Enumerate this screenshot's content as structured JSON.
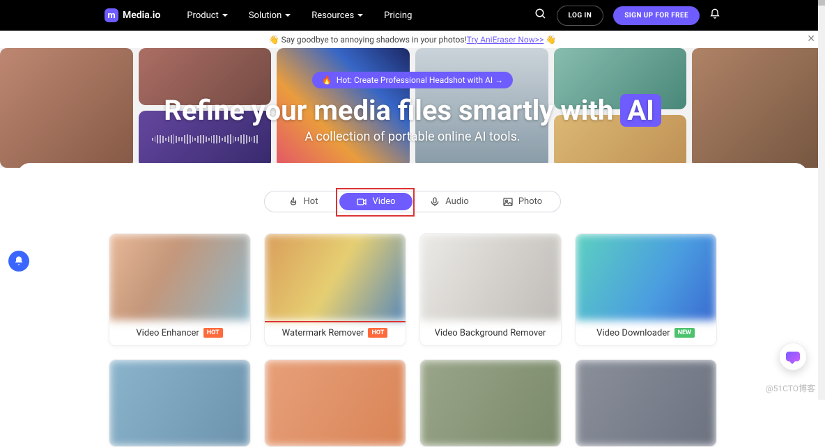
{
  "brand": "Media.io",
  "nav": {
    "product": "Product",
    "solution": "Solution",
    "resources": "Resources",
    "pricing": "Pricing"
  },
  "header": {
    "login": "LOG IN",
    "signup": "SIGN UP FOR FREE"
  },
  "promo": {
    "emoji": "👋",
    "text": "Say goodbye to annoying shadows in your photos! ",
    "link": "Try AniEraser Now>>",
    "emoji2": "👋"
  },
  "hero": {
    "hot": "Hot: Create Professional Headshot with AI →",
    "title_pre": "Refine your media files smartly with ",
    "title_ai": "AI",
    "subtitle": "A collection of portable online AI tools."
  },
  "tabs": {
    "hot": "Hot",
    "video": "Video",
    "audio": "Audio",
    "photo": "Photo"
  },
  "cards": [
    {
      "title": "Video Enhancer",
      "badge": "HOT",
      "badge_kind": "hot"
    },
    {
      "title": "Watermark Remover",
      "badge": "HOT",
      "badge_kind": "hot"
    },
    {
      "title": "Video Background Remover",
      "badge": "",
      "badge_kind": ""
    },
    {
      "title": "Video Downloader",
      "badge": "NEW",
      "badge_kind": "new"
    }
  ],
  "watermark": "@51CTO博客"
}
